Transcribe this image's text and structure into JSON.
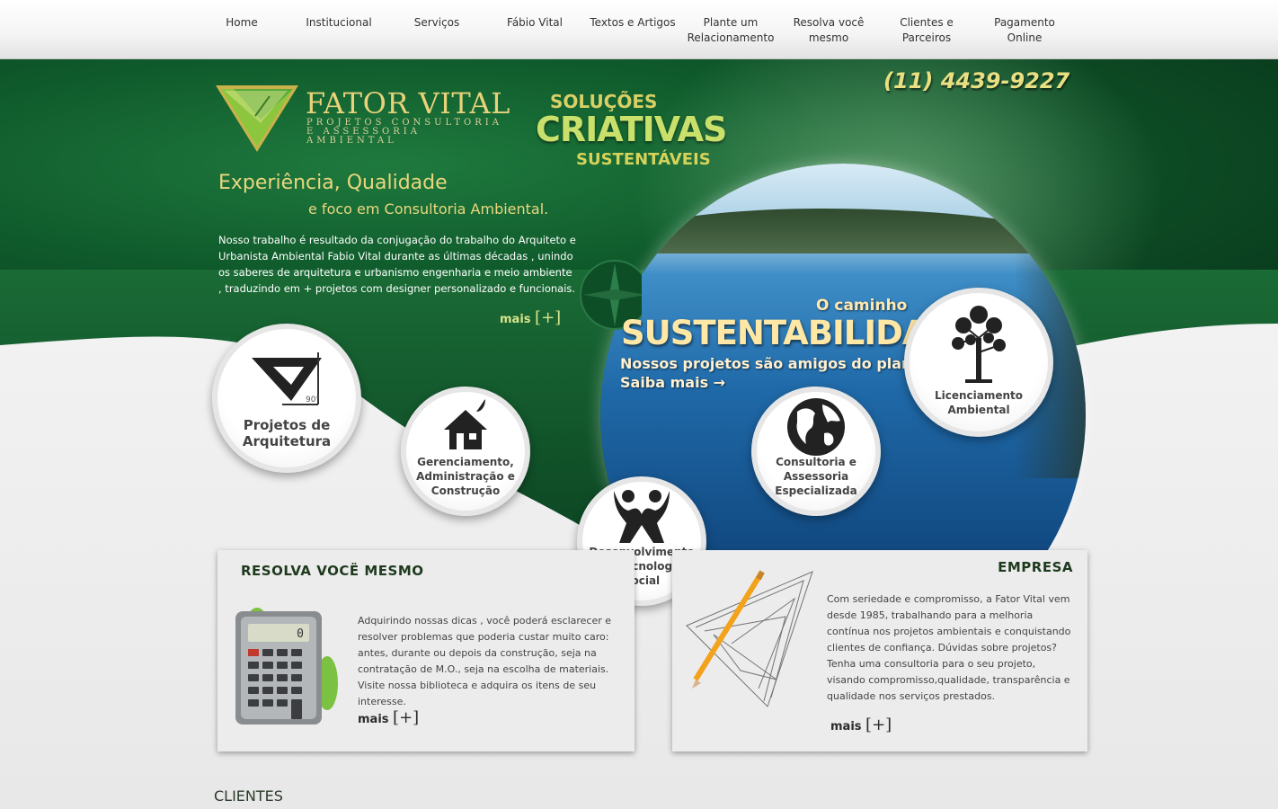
{
  "nav": {
    "items": [
      {
        "label": "Home"
      },
      {
        "label": "Institucional"
      },
      {
        "label": "Serviços"
      },
      {
        "label": "Fábio Vital"
      },
      {
        "label": "Textos e Artigos"
      },
      {
        "label": "Plante um\nRelacionamento"
      },
      {
        "label": "Resolva você\nmesmo"
      },
      {
        "label": "Clientes e\nParceiros"
      },
      {
        "label": "Pagamento\nOnline"
      }
    ]
  },
  "logo": {
    "title": "FATOR VITAL",
    "subtitle_line1": "PROJETOS CONSULTORIA",
    "subtitle_line2": "E ASSESSORIA AMBIENTAL"
  },
  "tagline": {
    "line1": "SOLUÇÕES",
    "line2": "CRIATIVAS",
    "line3": "SUSTENTÁVEIS"
  },
  "phone": "(11) 4439-9227",
  "hero": {
    "heading1": "Experiência, Qualidade",
    "heading2": "e foco em Consultoria Ambiental.",
    "intro": "Nosso trabalho é resultado da conjugação do trabalho do Arquiteto e Urbanista Ambiental Fabio Vital durante as últimas décadas , unindo os saberes de arquitetura e urbanismo engenharia e meio ambiente  , traduzindo em + projetos com designer personalizado e funcionais.",
    "more_label": "mais",
    "more_symbol": "[+]"
  },
  "banner": {
    "kicker": "O caminho",
    "title": "SUSTENTABILIDADE",
    "subtitle": "Nossos projetos são amigos do planeta",
    "link": "Saiba mais →"
  },
  "services": [
    {
      "label_line1": "Projetos de",
      "label_line2": "Arquitetura",
      "label_line3": "",
      "icon": "set-square-icon"
    },
    {
      "label_line1": "Gerenciamento,",
      "label_line2": "Administração e",
      "label_line3": "Construção",
      "icon": "house-icon"
    },
    {
      "label_line1": "Desenvolvimento",
      "label_line2": "de Tecnologia",
      "label_line3": "Social",
      "icon": "people-icon"
    },
    {
      "label_line1": "Consultoria e",
      "label_line2": "Assessoria",
      "label_line3": "Especializada",
      "icon": "globe-icon"
    },
    {
      "label_line1": "Licenciamento",
      "label_line2": "Ambiental",
      "label_line3": "",
      "icon": "tree-icon"
    }
  ],
  "resolva": {
    "title": "RESOLVA VOCË MESMO",
    "text": "Adquirindo nossas dicas , você poderá esclarecer e resolver problemas que poderia custar muito caro: antes, durante ou depois da construção, seja na contratação de M.O., seja na escolha de materiais. Visite nossa biblioteca e adquira os itens de seu interesse.",
    "more_label": "mais",
    "more_symbol": "[+]",
    "calc_display": "0"
  },
  "empresa": {
    "title": "EMPRESA",
    "text": "Com seriedade e compromisso, a Fator Vital vem desde 1985, trabalhando para a melhoria contínua nos projetos ambientais e conquistando clientes de confiança. Dúvidas sobre projetos? Tenha uma consultoria para o seu projeto, visando compromisso,qualidade, transparência e qualidade nos serviços prestados.",
    "more_label": "mais",
    "more_symbol": "[+]"
  },
  "clientes_title": "CLIENTES",
  "colors": {
    "hero_green": "#0f5a2b",
    "gold": "#e9d77e",
    "lake_blue": "#1f69a8",
    "panel_bg": "#ececec"
  }
}
